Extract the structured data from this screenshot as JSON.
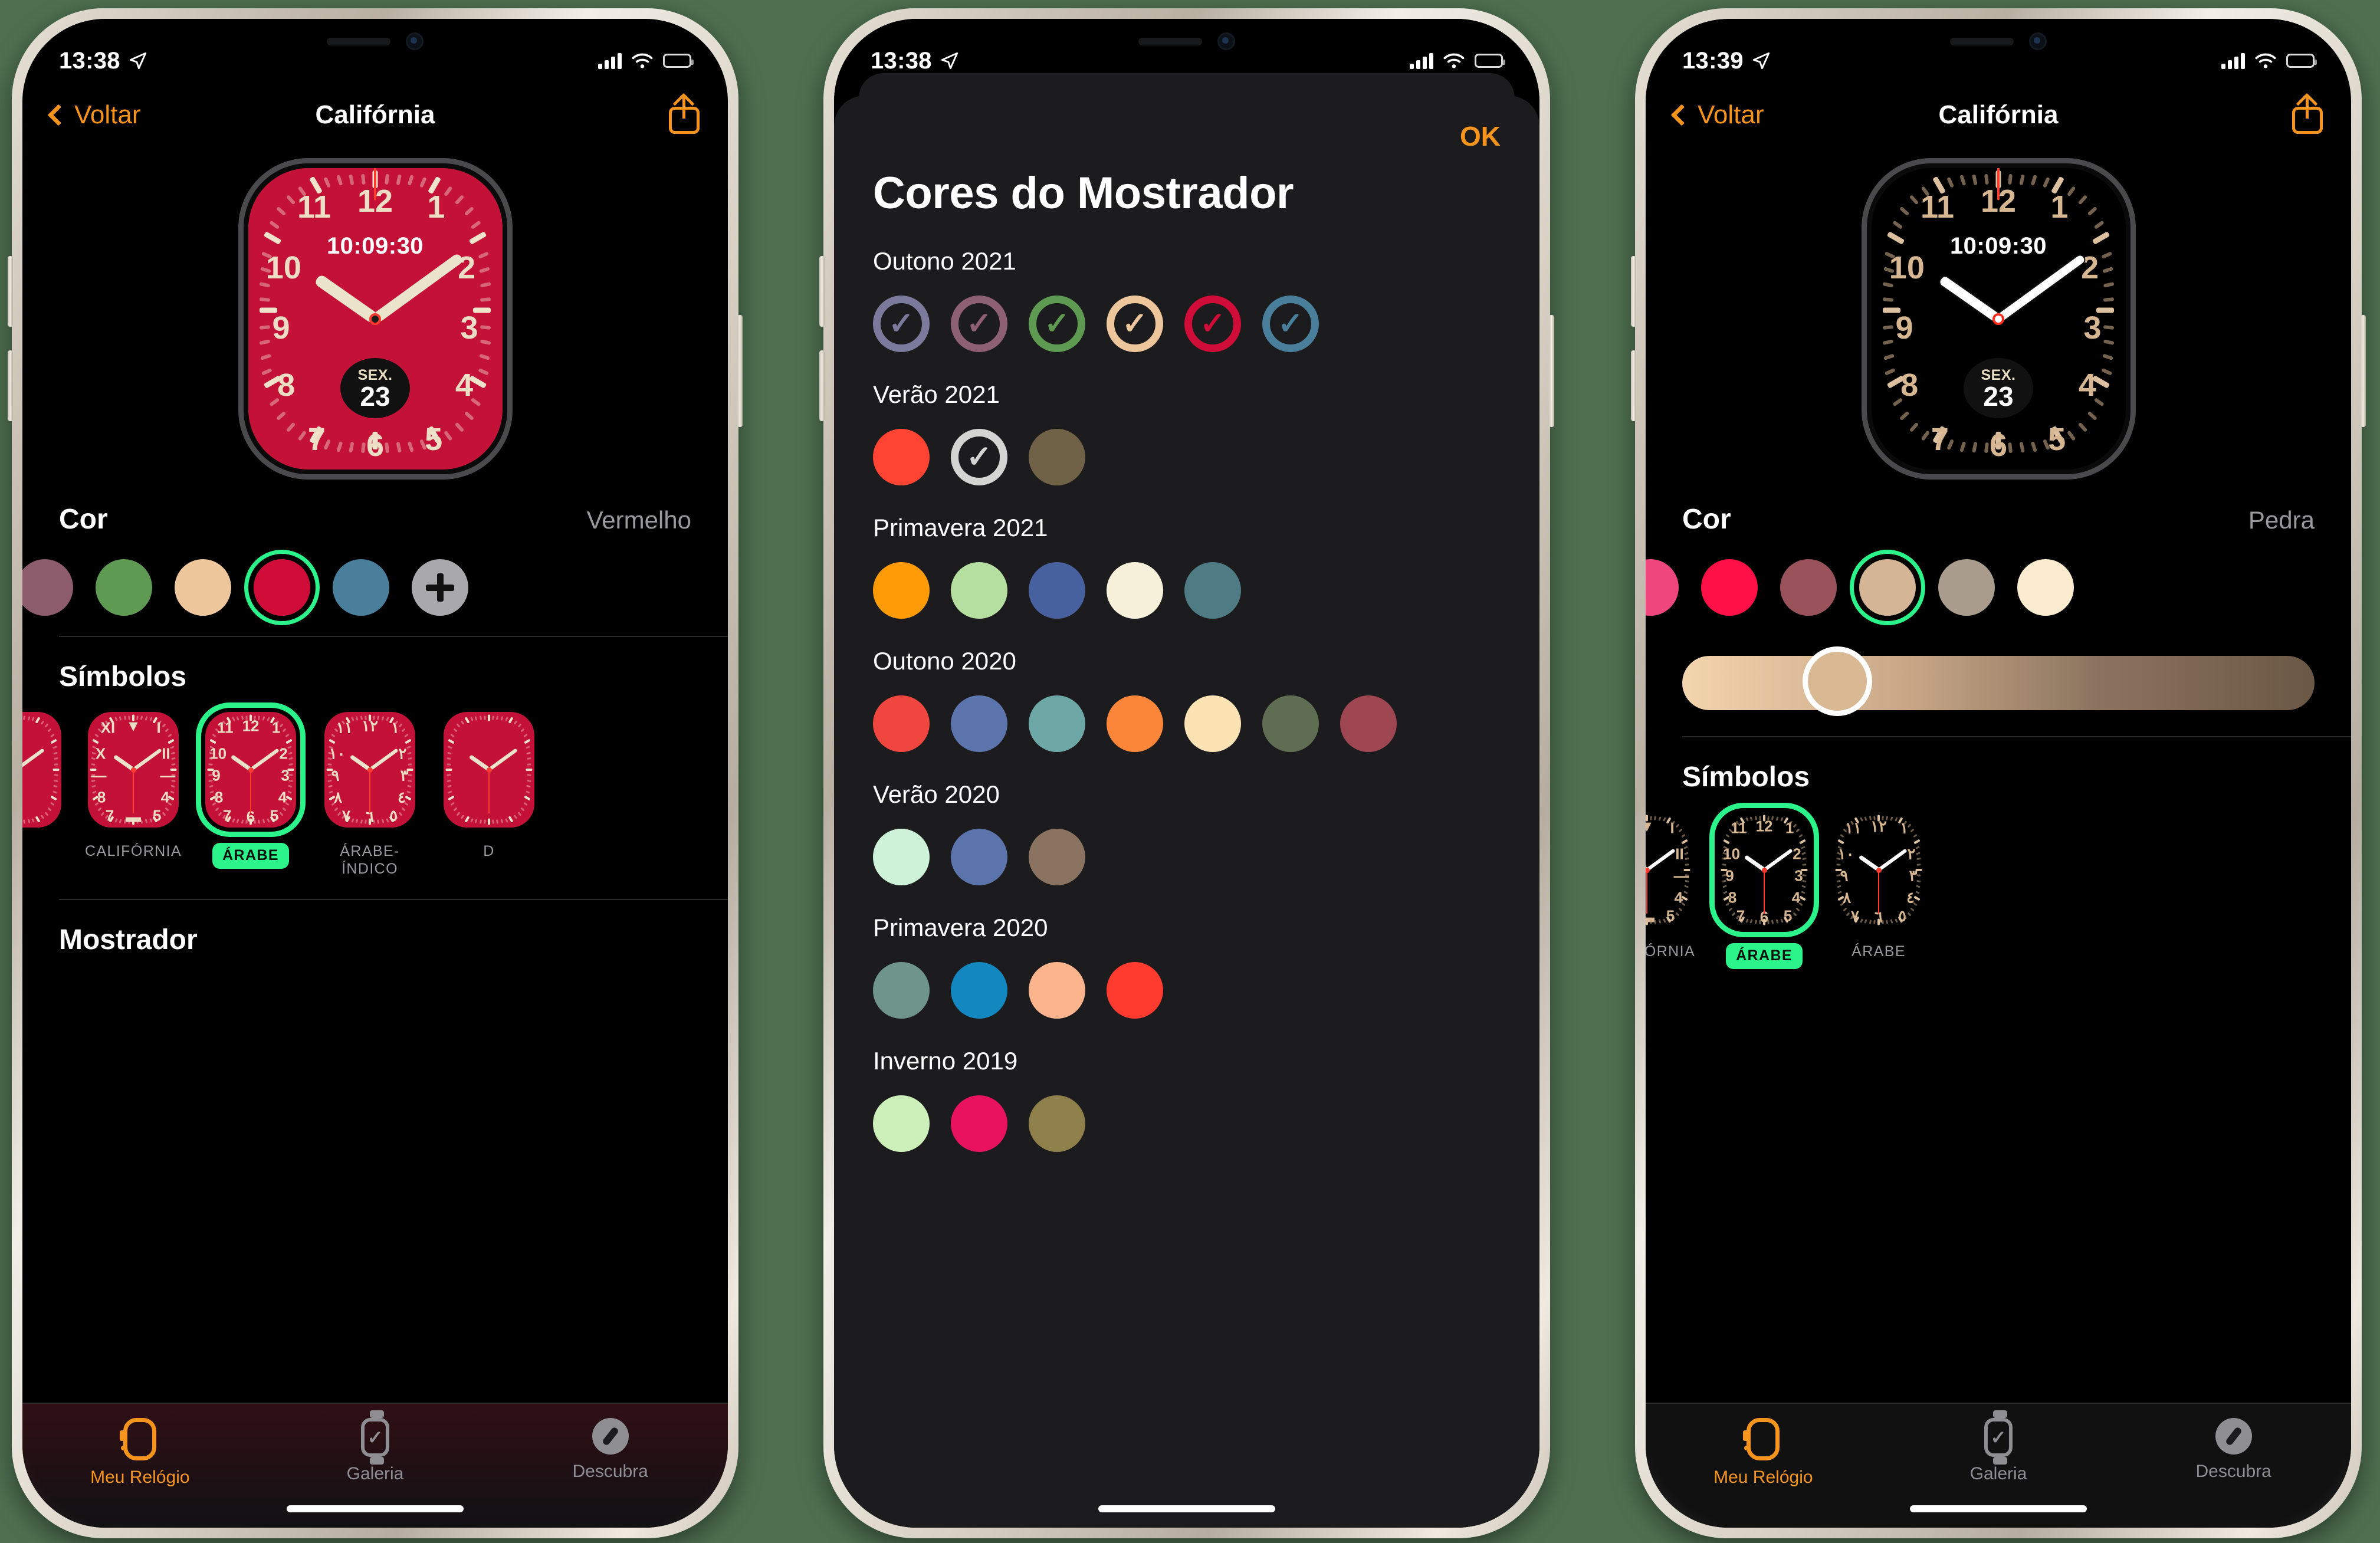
{
  "accent": "#f7941e",
  "selection_green": "#2bf58a",
  "phone1": {
    "status": {
      "time": "13:38",
      "location_icon": "location-arrow-icon"
    },
    "nav": {
      "back_label": "Voltar",
      "title": "Califórnia",
      "share_icon": "share-icon"
    },
    "watch": {
      "digital_time": "10:09:30",
      "numerals": [
        "11",
        "12",
        "1",
        "10",
        "2",
        "9",
        "3",
        "8",
        "4",
        "7",
        "6",
        "5"
      ],
      "date_dow": "SEX.",
      "date_num": "23",
      "face_color": "#c41138"
    },
    "color_section": {
      "title": "Cor",
      "value": "Vermelho"
    },
    "swatches": [
      {
        "name": "mauve",
        "hex": "#8d5d6e",
        "selected": false
      },
      {
        "name": "green",
        "hex": "#5e9a52",
        "selected": false
      },
      {
        "name": "sand",
        "hex": "#edc69c",
        "selected": false
      },
      {
        "name": "red",
        "hex": "#d00d38",
        "selected": true
      },
      {
        "name": "blue",
        "hex": "#4a7f9b",
        "selected": false
      },
      {
        "name": "add",
        "hex": "#a8a8ad",
        "selected": false,
        "is_plus": true
      }
    ],
    "symbols_section": {
      "title": "Símbolos"
    },
    "symbols": [
      {
        "label": "",
        "style": "partial",
        "selected": false
      },
      {
        "label": "CALIFÓRNIA",
        "style": "roman",
        "selected": false
      },
      {
        "label": "ÁRABE",
        "style": "arabic",
        "selected": true
      },
      {
        "label": "ÁRABE-ÍNDICO",
        "style": "indic",
        "selected": false
      },
      {
        "label": "D",
        "style": "partial2",
        "selected": false
      }
    ],
    "next_section_title": "Mostrador",
    "tabs": [
      {
        "label": "Meu Relógio",
        "icon": "watch-outline-icon",
        "active": true
      },
      {
        "label": "Galeria",
        "icon": "watch-check-icon",
        "active": false
      },
      {
        "label": "Descubra",
        "icon": "compass-icon",
        "active": false
      }
    ]
  },
  "phone2": {
    "status": {
      "time": "13:38",
      "location_icon": "location-arrow-icon"
    },
    "sheet": {
      "ok_label": "OK",
      "title": "Cores do Mostrador"
    },
    "palettes": [
      {
        "name": "Outono 2021",
        "ring": true,
        "colors": [
          {
            "hex": "#7a7a9c",
            "checked": true
          },
          {
            "hex": "#8d6072",
            "checked": true
          },
          {
            "hex": "#5e9a52",
            "checked": true
          },
          {
            "hex": "#edc69c",
            "checked": true
          },
          {
            "hex": "#d00d38",
            "checked": true
          },
          {
            "hex": "#4a7f9b",
            "checked": true
          }
        ]
      },
      {
        "name": "Verão 2021",
        "ring": false,
        "colors": [
          {
            "hex": "#ff4433",
            "checked": false
          },
          {
            "hex": "#d4d4d2",
            "checked": true,
            "ring_only": true
          },
          {
            "hex": "#6f6246",
            "checked": false
          }
        ]
      },
      {
        "name": "Primavera 2021",
        "ring": false,
        "colors": [
          {
            "hex": "#ff9b07",
            "checked": false
          },
          {
            "hex": "#b5dfa1",
            "checked": false
          },
          {
            "hex": "#46619e",
            "checked": false
          },
          {
            "hex": "#f7f1dc",
            "checked": false
          },
          {
            "hex": "#4e7b84",
            "checked": false
          }
        ]
      },
      {
        "name": "Outono 2020",
        "ring": false,
        "colors": [
          {
            "hex": "#ef4640",
            "checked": false
          },
          {
            "hex": "#5c74ac",
            "checked": false
          },
          {
            "hex": "#6ea8a6",
            "checked": false
          },
          {
            "hex": "#fb8539",
            "checked": false
          },
          {
            "hex": "#fce3b4",
            "checked": false
          },
          {
            "hex": "#5f6e53",
            "checked": false
          },
          {
            "hex": "#9e4652",
            "checked": false
          }
        ]
      },
      {
        "name": "Verão 2020",
        "ring": false,
        "colors": [
          {
            "hex": "#cdf2d8",
            "checked": false
          },
          {
            "hex": "#5c74ac",
            "checked": false
          },
          {
            "hex": "#8a7461",
            "checked": false
          }
        ]
      },
      {
        "name": "Primavera 2020",
        "ring": false,
        "colors": [
          {
            "hex": "#6f958b",
            "checked": false
          },
          {
            "hex": "#1287c0",
            "checked": false
          },
          {
            "hex": "#fbb48c",
            "checked": false
          },
          {
            "hex": "#ff3b30",
            "checked": false
          }
        ]
      },
      {
        "name": "Inverno 2019",
        "ring": false,
        "colors": [
          {
            "hex": "#cdf0bb",
            "checked": false
          },
          {
            "hex": "#e8125e",
            "checked": false
          },
          {
            "hex": "#8e7f4b",
            "checked": false
          }
        ]
      }
    ]
  },
  "phone3": {
    "status": {
      "time": "13:39",
      "location_icon": "location-arrow-icon"
    },
    "nav": {
      "back_label": "Voltar",
      "title": "Califórnia",
      "share_icon": "share-icon"
    },
    "watch": {
      "digital_time": "10:09:30",
      "numerals": [
        "11",
        "12",
        "1",
        "10",
        "2",
        "9",
        "3",
        "8",
        "4",
        "7",
        "6",
        "5"
      ],
      "date_dow": "SEX.",
      "date_num": "23",
      "face_color": "#000000"
    },
    "color_section": {
      "title": "Cor",
      "value": "Pedra"
    },
    "swatches": [
      {
        "name": "pink",
        "hex": "#ef467e",
        "selected": false
      },
      {
        "name": "hot-pink",
        "hex": "#ff1148",
        "selected": false
      },
      {
        "name": "rosewood",
        "hex": "#99515a",
        "selected": false
      },
      {
        "name": "stone",
        "hex": "#d4b596",
        "selected": true
      },
      {
        "name": "taupe",
        "hex": "#a99c8d",
        "selected": false
      },
      {
        "name": "cream",
        "hex": "#fbecd0",
        "selected": false
      }
    ],
    "slider": {
      "from": "#f3d5ae",
      "to": "#6b5745",
      "knob_hex": "#d9b894",
      "knob_pos_pct": 22
    },
    "symbols_section": {
      "title": "Símbolos"
    },
    "symbols": [
      {
        "label": "CALIFÓRNIA",
        "style": "roman",
        "selected": false
      },
      {
        "label": "ÁRABE",
        "style": "arabic",
        "selected": true
      },
      {
        "label": "ÁRABE",
        "style": "indic",
        "selected": false
      }
    ],
    "tabs": [
      {
        "label": "Meu Relógio",
        "icon": "watch-outline-icon",
        "active": true
      },
      {
        "label": "Galeria",
        "icon": "watch-check-icon",
        "active": false
      },
      {
        "label": "Descubra",
        "icon": "compass-icon",
        "active": false
      }
    ]
  }
}
